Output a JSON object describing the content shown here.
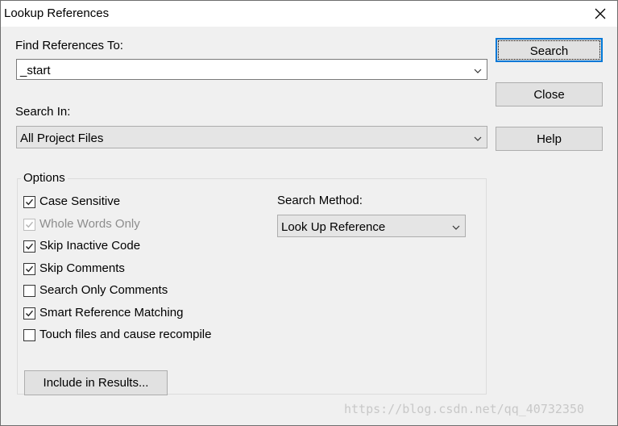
{
  "window": {
    "title": "Lookup References"
  },
  "find": {
    "label": "Find References To:",
    "value": "_start"
  },
  "search_in": {
    "label": "Search In:",
    "value": "All Project Files"
  },
  "buttons": {
    "search": "Search",
    "close": "Close",
    "help": "Help",
    "include": "Include in Results..."
  },
  "options": {
    "caption": "Options",
    "checkboxes": [
      {
        "label": "Case Sensitive",
        "checked": true,
        "enabled": true
      },
      {
        "label": "Whole Words Only",
        "checked": true,
        "enabled": false
      },
      {
        "label": "Skip Inactive Code",
        "checked": true,
        "enabled": true
      },
      {
        "label": "Skip Comments",
        "checked": true,
        "enabled": true
      },
      {
        "label": "Search Only Comments",
        "checked": false,
        "enabled": true
      },
      {
        "label": "Smart Reference Matching",
        "checked": true,
        "enabled": true
      },
      {
        "label": "Touch files and cause recompile",
        "checked": false,
        "enabled": true
      }
    ],
    "method_label": "Search Method:",
    "method_value": "Look Up Reference"
  },
  "watermark": "https://blog.csdn.net/qq_40732350",
  "colors": {
    "dialog_bg": "#f0f0f0",
    "default_button_border": "#0078d7",
    "disabled_text": "#8d8d8d"
  },
  "icons": {
    "close": "close-icon",
    "dropdown": "chevron-down-icon",
    "check": "check-icon"
  }
}
